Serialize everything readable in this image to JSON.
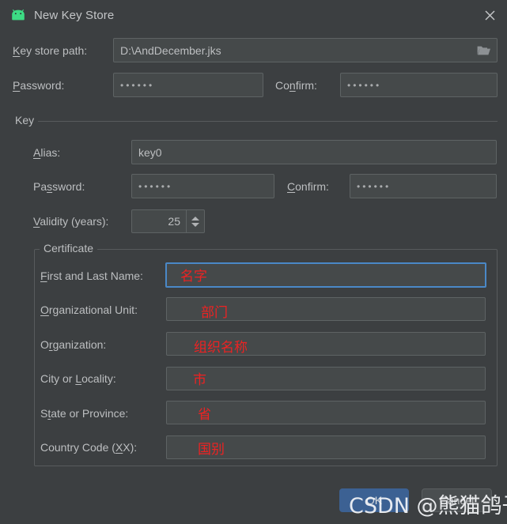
{
  "window": {
    "title": "New Key Store",
    "app_icon": "android-icon",
    "close_icon": "close-icon"
  },
  "keystore": {
    "path_label_prefix": "",
    "path_label": "Key store path:",
    "path_mnemonic": "K",
    "path_value": "D:\\AndDecember.jks",
    "browse_icon": "folder-icon",
    "password_label": "Password:",
    "password_mnemonic": "P",
    "password_value": "••••••",
    "confirm_label": "Confirm:",
    "confirm_mnemonic": "n",
    "confirm_value": "••••••"
  },
  "key_group": {
    "title": "Key",
    "alias_label": "Alias:",
    "alias_mnemonic": "A",
    "alias_value": "key0",
    "password_label": "Password:",
    "password_mnemonic": "s",
    "password_value": "••••••",
    "confirm_label": "Confirm:",
    "confirm_mnemonic": "C",
    "confirm_value": "••••••",
    "validity_label": "Validity (years):",
    "validity_mnemonic": "V",
    "validity_value": "25"
  },
  "certificate": {
    "title": "Certificate",
    "fields": [
      {
        "label": "First and Last Name:",
        "mnemonic": "F",
        "value": "",
        "annotation": "名字",
        "focused": true
      },
      {
        "label": "Organizational Unit:",
        "mnemonic": "O",
        "value": "",
        "annotation": "部门",
        "focused": false
      },
      {
        "label": "Organization:",
        "mnemonic": "r",
        "value": "",
        "annotation": "组织名称",
        "focused": false
      },
      {
        "label": "City or Locality:",
        "mnemonic": "L",
        "value": "",
        "annotation": "市",
        "focused": false
      },
      {
        "label": "State or Province:",
        "mnemonic": "t",
        "value": "",
        "annotation": "省",
        "focused": false
      },
      {
        "label": "Country Code (XX):",
        "mnemonic": "X",
        "value": "",
        "annotation": "国别",
        "focused": false
      }
    ]
  },
  "footer": {
    "ok_label": "OK",
    "cancel_label": "Cancel"
  },
  "watermark": {
    "text": "CSDN @熊猫鸽子汤"
  },
  "colors": {
    "dialog_bg": "#3c3f41",
    "field_bg": "#45494a",
    "field_border": "#5e6364",
    "focus_border": "#4a88c7",
    "text": "#bdbfc1",
    "annotation_red": "#ee2222",
    "ok_button": "#3c6193",
    "android_green": "#3ddc84"
  }
}
